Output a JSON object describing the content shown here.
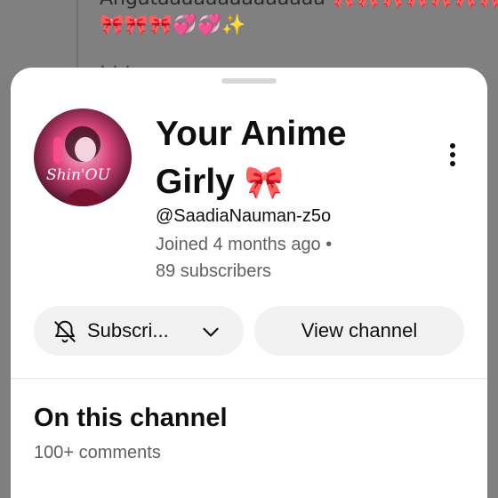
{
  "background": {
    "line1": "Angataaaaaaaaaaaaaa 🎀🎀🎀🎀🎀🎀🎀",
    "line2": "🎀🎀🎀💞💞✨",
    "line3": "· · ·"
  },
  "channel": {
    "name": "Your Anime Girly",
    "name_emoji": "🎀",
    "handle": "@SaadiaNauman-z5o",
    "joined": "Joined 4 months ago •",
    "subscribers": "89 subscribers",
    "avatar_text": "Shin'OU"
  },
  "actions": {
    "subscribe_label": "Subscri...",
    "view_label": "View channel"
  },
  "section": {
    "title": "On this channel",
    "comments": "100+ comments"
  },
  "colors": {
    "accent": "#e02d3c",
    "sheet": "#ffffff",
    "button_bg": "#f2f2f2",
    "secondary_text": "#606060"
  },
  "icons": [
    "bell-icon",
    "chevron-down-icon",
    "more-vert-icon"
  ]
}
